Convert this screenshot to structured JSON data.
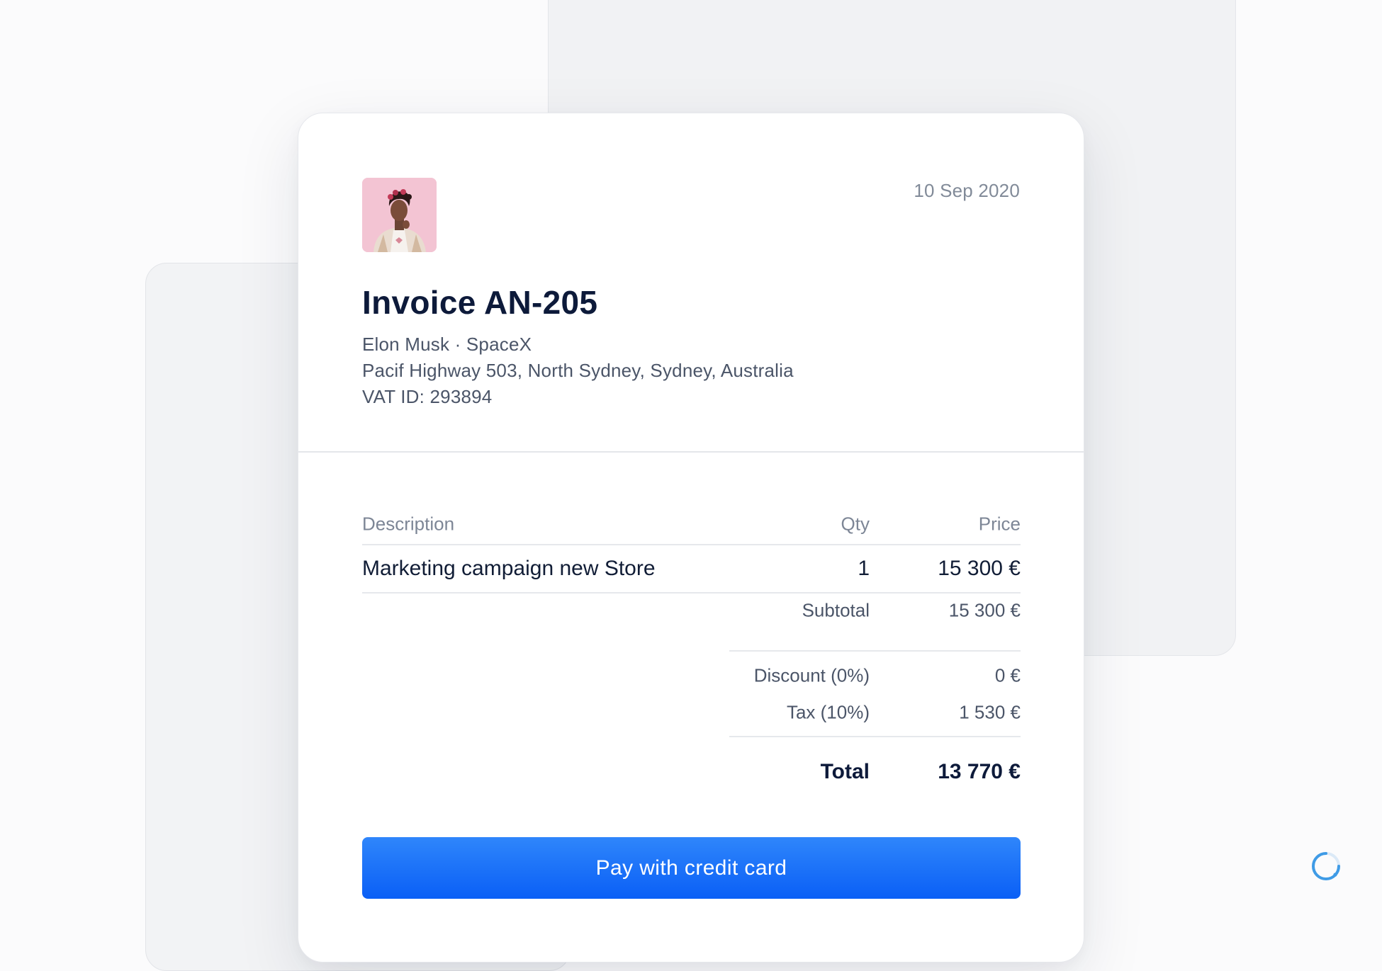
{
  "invoice": {
    "date": "10 Sep 2020",
    "title": "Invoice AN-205",
    "client": {
      "name_line": "Elon Musk · SpaceX",
      "address": "Pacif Highway 503, North Sydney, Sydney, Australia",
      "vat": "VAT ID: 293894"
    },
    "table": {
      "headers": {
        "description": "Description",
        "qty": "Qty",
        "price": "Price"
      },
      "rows": [
        {
          "description": "Marketing campaign new Store",
          "qty": "1",
          "price": "15 300 €"
        }
      ]
    },
    "summary": {
      "subtotal_label": "Subtotal",
      "subtotal_value": "15 300 €",
      "discount_label": "Discount (0%)",
      "discount_value": "0 €",
      "tax_label": "Tax (10%)",
      "tax_value": "1 530 €",
      "total_label": "Total",
      "total_value": "13 770 €"
    },
    "pay_button_label": "Pay with credit card"
  },
  "icons": {
    "avatar": "user-photo",
    "loader": "loading-spinner-icon"
  },
  "colors": {
    "accent": "#0a5ff6",
    "title": "#0d1a3a",
    "muted": "#818a98"
  }
}
